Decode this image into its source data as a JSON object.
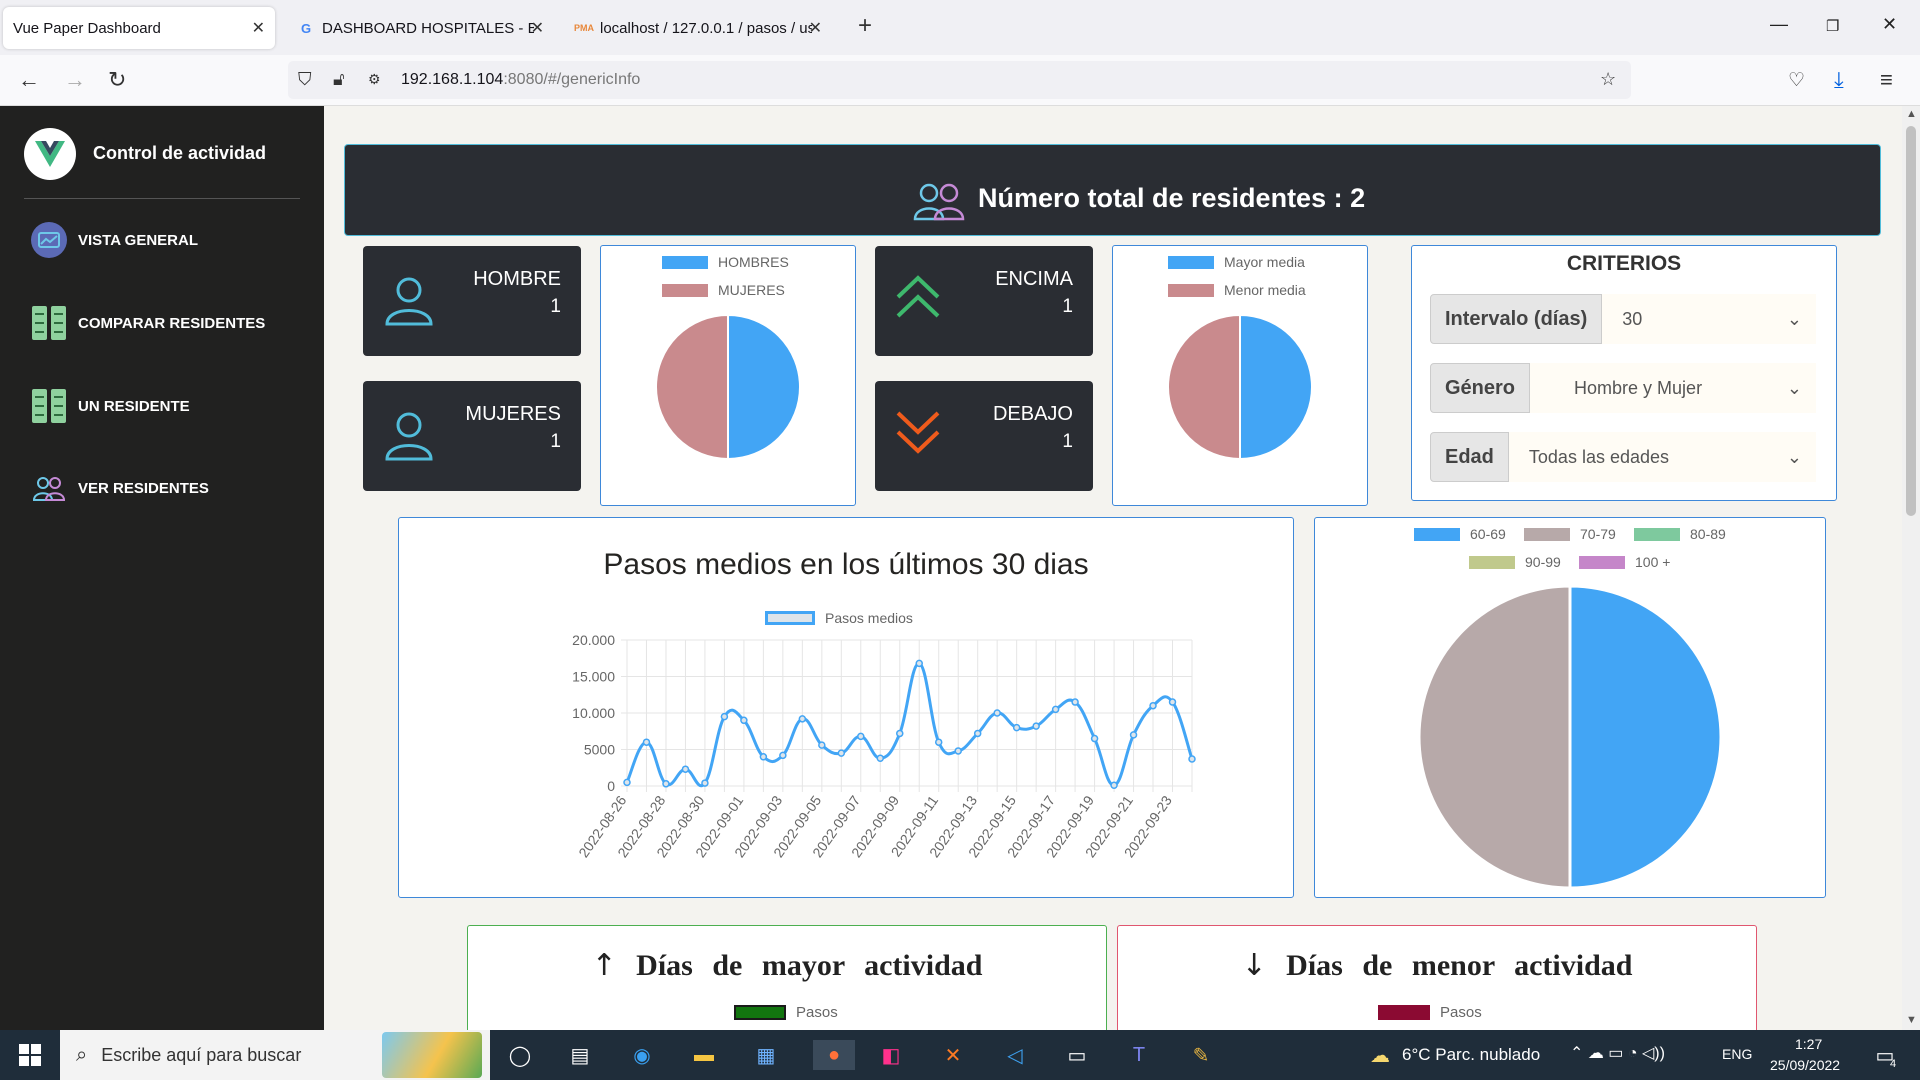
{
  "browser": {
    "tabs": [
      {
        "title": "Vue Paper Dashboard",
        "active": true
      },
      {
        "title": "DASHBOARD HOSPITALES - Bú",
        "active": false
      },
      {
        "title": "localhost / 127.0.0.1 / pasos / us",
        "active": false
      }
    ],
    "url_host": "192.168.1.104",
    "url_rest": ":8080/#/genericInfo"
  },
  "sidebar": {
    "brand": "Control de actividad",
    "items": [
      {
        "label": "VISTA GENERAL",
        "icon": "dashboard-icon",
        "active": true
      },
      {
        "label": "COMPARAR RESIDENTES",
        "icon": "checklist-icon",
        "active": false
      },
      {
        "label": "UN RESIDENTE",
        "icon": "checklist-icon",
        "active": false
      },
      {
        "label": "VER RESIDENTES",
        "icon": "users-icon",
        "active": false
      }
    ]
  },
  "header": {
    "title": "Número total de residentes : 2"
  },
  "stats": {
    "hombre": {
      "label": "HOMBRE",
      "value": "1"
    },
    "mujeres": {
      "label": "MUJERES",
      "value": "1"
    },
    "encima": {
      "label": "ENCIMA",
      "value": "1"
    },
    "debajo": {
      "label": "DEBAJO",
      "value": "1"
    }
  },
  "gender_pie": {
    "legend": [
      "HOMBRES",
      "MUJERES"
    ],
    "colors": [
      "#42a5f5",
      "#c98a8d"
    ],
    "values": [
      1,
      1
    ]
  },
  "avg_pie": {
    "legend": [
      "Mayor media",
      "Menor media"
    ],
    "colors": [
      "#42a5f5",
      "#c98a8d"
    ],
    "values": [
      1,
      1
    ]
  },
  "criterios": {
    "title": "CRITERIOS",
    "rows": [
      {
        "label": "Intervalo (días)",
        "value": "30"
      },
      {
        "label": "Género",
        "value": "Hombre y Mujer"
      },
      {
        "label": "Edad",
        "value": "Todas las edades"
      }
    ]
  },
  "chart_data": [
    {
      "type": "line",
      "title": "Pasos medios en los últimos 30 dias",
      "series": [
        {
          "name": "Pasos medios",
          "color": "#42a5f5",
          "values": [
            500,
            6000,
            300,
            2300,
            400,
            9500,
            9000,
            4000,
            4200,
            9200,
            5600,
            4500,
            6800,
            3800,
            7200,
            16800,
            6000,
            4800,
            7200,
            10000,
            8000,
            8200,
            10500,
            11500,
            6500,
            100,
            7000,
            11000,
            11500,
            3700
          ]
        }
      ],
      "x": [
        "2022-08-26",
        "2022-08-27",
        "2022-08-28",
        "2022-08-29",
        "2022-08-30",
        "2022-08-31",
        "2022-09-01",
        "2022-09-02",
        "2022-09-03",
        "2022-09-04",
        "2022-09-05",
        "2022-09-06",
        "2022-09-07",
        "2022-09-08",
        "2022-09-09",
        "2022-09-10",
        "2022-09-11",
        "2022-09-12",
        "2022-09-13",
        "2022-09-14",
        "2022-09-15",
        "2022-09-16",
        "2022-09-17",
        "2022-09-18",
        "2022-09-19",
        "2022-09-20",
        "2022-09-21",
        "2022-09-22",
        "2022-09-23",
        "2022-09-24"
      ],
      "x_tick_labels": [
        "2022-08-26",
        "2022-08-28",
        "2022-08-30",
        "2022-09-01",
        "2022-09-03",
        "2022-09-05",
        "2022-09-07",
        "2022-09-09",
        "2022-09-11",
        "2022-09-13",
        "2022-09-15",
        "2022-09-17",
        "2022-09-19",
        "2022-09-21",
        "2022-09-23"
      ],
      "y_ticks": [
        "20.000",
        "15.000",
        "10.000",
        "5000",
        "0"
      ],
      "ylim": [
        0,
        20000
      ],
      "grid": true,
      "legend_position": "top"
    },
    {
      "type": "pie",
      "categories": [
        "60-69",
        "70-79",
        "80-89",
        "90-99",
        "100 +"
      ],
      "colors": [
        "#42a5f5",
        "#b7a9a9",
        "#7ec99e",
        "#c0c98c",
        "#c586c9"
      ],
      "values": [
        1,
        1,
        0,
        0,
        0
      ],
      "legend_position": "top"
    }
  ],
  "mayor": {
    "title": "Días de mayor actividad",
    "legend": "Pasos",
    "color": "#12750f",
    "border": "#4caf50"
  },
  "menor": {
    "title": "Días de menor actividad",
    "legend": "Pasos",
    "color": "#8b0a32",
    "border": "#e0566f"
  },
  "taskbar": {
    "search_placeholder": "Escribe aquí para buscar",
    "weather": "6°C  Parc. nublado",
    "lang": "ENG",
    "time": "1:27",
    "date": "25/09/2022",
    "notifications": "4"
  }
}
